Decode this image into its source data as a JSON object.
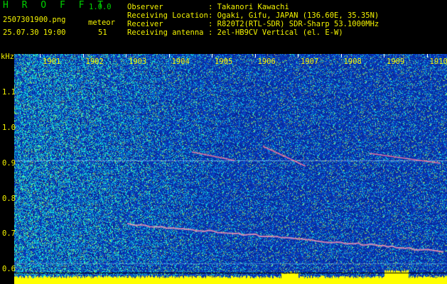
{
  "header": {
    "app_name": "H R O F F T",
    "version": "1.0.0",
    "filename": "2507301900.png",
    "detector_label": "meteor",
    "timestamp": "25.07.30 19:00",
    "count": "51",
    "info": [
      {
        "label": "Observer",
        "value": "Takanori Kawachi"
      },
      {
        "label": "Receiving Location",
        "value": "Ogaki, Gifu, JAPAN (136.60E, 35.35N)"
      },
      {
        "label": "Receiver",
        "value": "R820T2(RTL-SDR) SDR-Sharp 53.1000MHz"
      },
      {
        "label": "Receiving antenna",
        "value": "2el-HB9CV Vertical (el. E-W)"
      }
    ]
  },
  "axis": {
    "unit": "kHz",
    "x_labels": [
      "1901",
      "1902",
      "1903",
      "1904",
      "1905",
      "1906",
      "1907",
      "1908",
      "1909",
      "1910"
    ],
    "y_labels": [
      "1.1",
      "1.0",
      "0.9",
      "0.8",
      "0.7",
      "0.6"
    ]
  },
  "colors": {
    "label_yellow": "#f4f400",
    "label_green": "#00d200",
    "background_noise": "#0a2a9a",
    "signal_bar": "#ffff00"
  }
}
